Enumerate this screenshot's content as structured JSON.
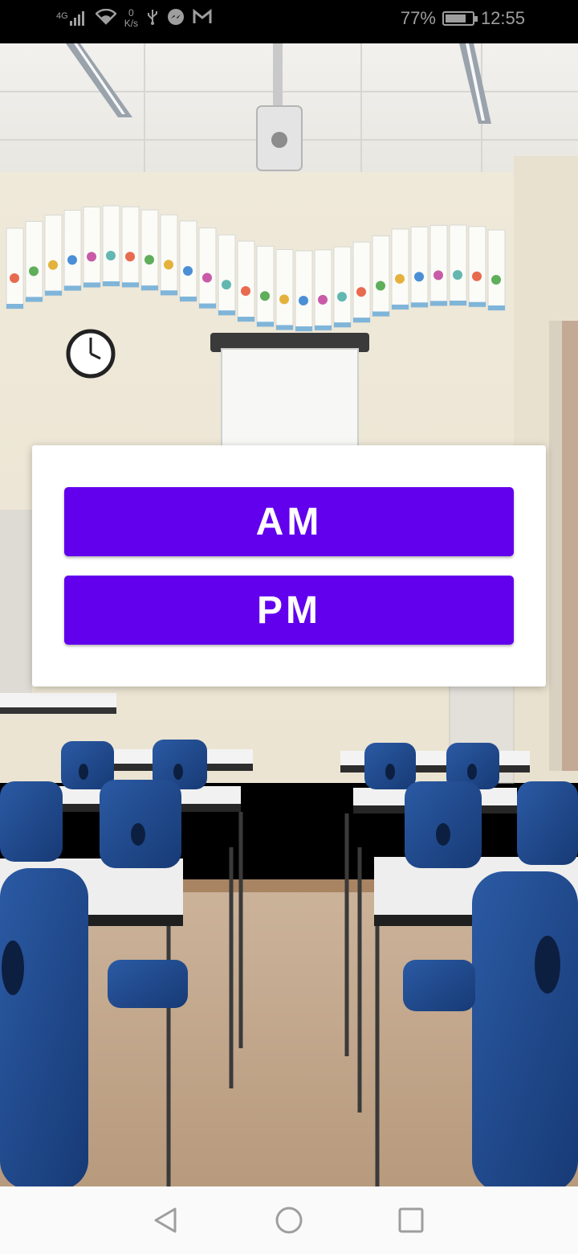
{
  "status_bar": {
    "network": "4G",
    "speed_value": "0",
    "speed_unit": "K/s",
    "battery_percent": "77%",
    "battery_level": 0.77,
    "time": "12:55",
    "icons": [
      "signal-icon",
      "wifi-icon",
      "usb-icon",
      "messenger-icon",
      "gmail-icon",
      "battery-icon"
    ]
  },
  "dialog": {
    "am_label": "AM",
    "pm_label": "PM"
  },
  "colors": {
    "button": "#6200ee",
    "button_text": "#ffffff",
    "dialog_bg": "#ffffff"
  },
  "nav_bar": {
    "icons": [
      "back-icon",
      "home-icon",
      "recents-icon"
    ]
  }
}
